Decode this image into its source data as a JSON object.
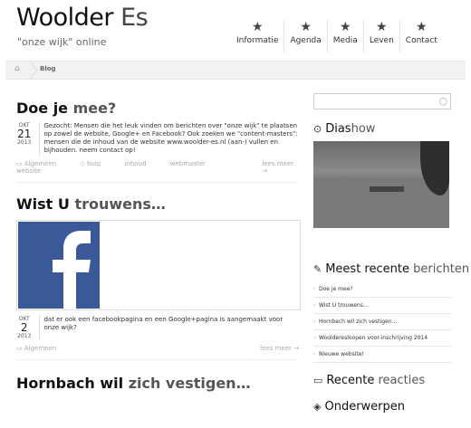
{
  "site": {
    "title_dark": "Woolder",
    "title_light": "Es",
    "tagline": "\"onze wijk\" online"
  },
  "nav": {
    "items": [
      {
        "label": "Informatie",
        "icon": "star-icon"
      },
      {
        "label": "Agenda",
        "icon": "star-icon"
      },
      {
        "label": "Media",
        "icon": "star-icon"
      },
      {
        "label": "Leven",
        "icon": "star-icon"
      },
      {
        "label": "Contact",
        "icon": "star-icon"
      }
    ]
  },
  "breadcrumb": {
    "home_icon": "home-icon",
    "current": "Blog"
  },
  "posts": [
    {
      "title_dark": "Doe je",
      "title_light": "mee?",
      "month": "OKT",
      "day": "21",
      "year": "2013",
      "excerpt": "Gezocht: Mensen die het leuk vinden om berichten over \"onze wijk\" te plaatsen op zowel de website, Google+ en Facebook? Ook zoeken we \"content-masters\": mensen die de inhoud van de website www.woolder-es.nl (aan-) vullen en bijhouden. neem contact op!",
      "category": "Algemeen",
      "tags": [
        "hulp",
        "inhoud",
        "webmaster",
        "website"
      ],
      "more": "lees meer →"
    },
    {
      "title_dark": "Wist U",
      "title_light": "trouwens…",
      "month": "OKT",
      "day": "2",
      "year": "2013",
      "excerpt": "dat er ook een facebookpagina en een Google+pagina is aangemaakt voor onze wijk?",
      "category": "Algemeen",
      "more": "lees meer →"
    },
    {
      "title_dark": "Hornbach wil",
      "title_light": "zich vestigen…"
    }
  ],
  "sidebar": {
    "search_icon": "search-icon",
    "diashow_title_dark": "Dias",
    "diashow_title_light": "how",
    "recent_title_dark": "Meest recente",
    "recent_title_light": "berichten",
    "recent_items": [
      "Doe je mee?",
      "Wist U trouwens…",
      "Hornbach wil zich vestigen…",
      "Woolderesloopen voor-inschrijving 2014",
      "Nieuwe website!"
    ],
    "reacties_title_dark": "Recente",
    "reacties_title_light": "reacties",
    "onderwerpen_title": "Onderwerpen"
  },
  "colors": {
    "facebook_blue": "#3b5998"
  }
}
